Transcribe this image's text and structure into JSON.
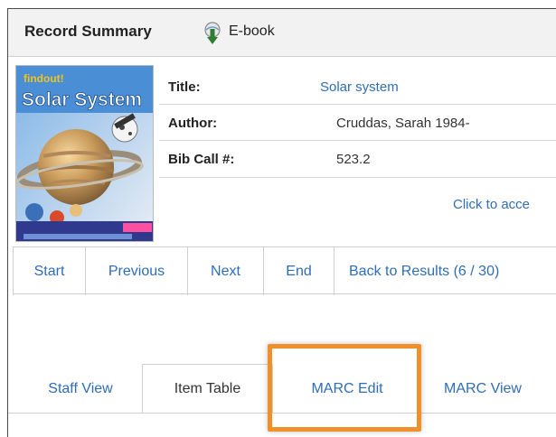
{
  "header": {
    "title": "Record Summary",
    "format_label": "E-book",
    "format_icon": "ebook-download-icon"
  },
  "record": {
    "title_label": "Title:",
    "title_value": "Solar system",
    "author_label": "Author:",
    "author_value": "Cruddas, Sarah 1984-",
    "call_label": "Bib Call #:",
    "call_value": "523.2",
    "access_link": "Click to acce"
  },
  "cover": {
    "series": "findout!",
    "title": "Solar System"
  },
  "nav": {
    "start": "Start",
    "previous": "Previous",
    "next": "Next",
    "end": "End",
    "back": "Back to Results (6 / 30)"
  },
  "tabs": {
    "staff_view": "Staff View",
    "item_table": "Item Table",
    "marc_edit": "MARC Edit",
    "marc_view": "MARC View"
  },
  "colors": {
    "link": "#2f6db5",
    "highlight": "#f0902a",
    "header_bg": "#f2f2f2"
  }
}
